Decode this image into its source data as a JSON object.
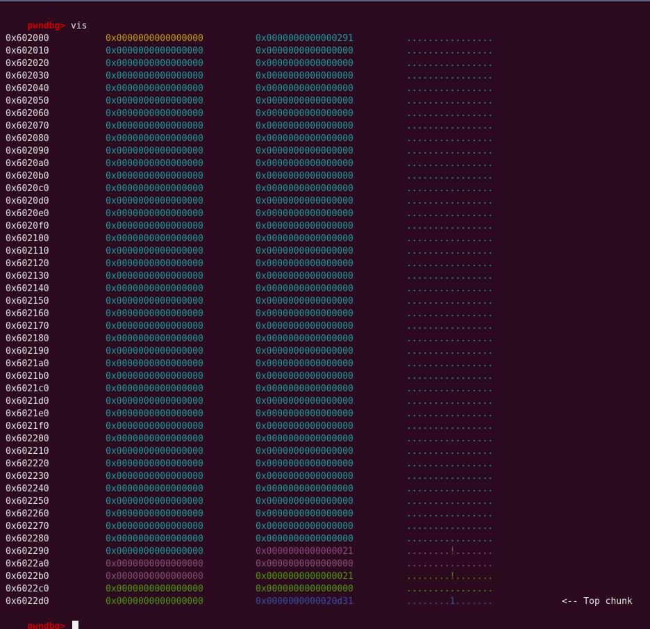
{
  "terminal": {
    "colors": {
      "background": "#2c0a1f",
      "prompt": "#cc0000",
      "text": "#e6e6e6",
      "cyan": "#1a9e9e",
      "yellow": "#c4a000",
      "purple": "#8a4f7a",
      "green": "#4e9a06",
      "blue": "#3b4fa8"
    },
    "prompt": "pwndbg>",
    "command": "vis",
    "final_prompt": "pwndbg>",
    "rows": [
      {
        "addr": "0x602000",
        "w1": "0x0000000000000000",
        "w2": "0x0000000000000291",
        "ascii": "................",
        "c1": "#c4a000",
        "c2": "#1a9e9e",
        "c3": "#1a9e9e",
        "ann": ""
      },
      {
        "addr": "0x602010",
        "w1": "0x0000000000000000",
        "w2": "0x0000000000000000",
        "ascii": "................",
        "c1": "#1a9e9e",
        "c2": "#1a9e9e",
        "c3": "#1a9e9e",
        "ann": ""
      },
      {
        "addr": "0x602020",
        "w1": "0x0000000000000000",
        "w2": "0x0000000000000000",
        "ascii": "................",
        "c1": "#1a9e9e",
        "c2": "#1a9e9e",
        "c3": "#1a9e9e",
        "ann": ""
      },
      {
        "addr": "0x602030",
        "w1": "0x0000000000000000",
        "w2": "0x0000000000000000",
        "ascii": "................",
        "c1": "#1a9e9e",
        "c2": "#1a9e9e",
        "c3": "#1a9e9e",
        "ann": ""
      },
      {
        "addr": "0x602040",
        "w1": "0x0000000000000000",
        "w2": "0x0000000000000000",
        "ascii": "................",
        "c1": "#1a9e9e",
        "c2": "#1a9e9e",
        "c3": "#1a9e9e",
        "ann": ""
      },
      {
        "addr": "0x602050",
        "w1": "0x0000000000000000",
        "w2": "0x0000000000000000",
        "ascii": "................",
        "c1": "#1a9e9e",
        "c2": "#1a9e9e",
        "c3": "#1a9e9e",
        "ann": ""
      },
      {
        "addr": "0x602060",
        "w1": "0x0000000000000000",
        "w2": "0x0000000000000000",
        "ascii": "................",
        "c1": "#1a9e9e",
        "c2": "#1a9e9e",
        "c3": "#1a9e9e",
        "ann": ""
      },
      {
        "addr": "0x602070",
        "w1": "0x0000000000000000",
        "w2": "0x0000000000000000",
        "ascii": "................",
        "c1": "#1a9e9e",
        "c2": "#1a9e9e",
        "c3": "#1a9e9e",
        "ann": ""
      },
      {
        "addr": "0x602080",
        "w1": "0x0000000000000000",
        "w2": "0x0000000000000000",
        "ascii": "................",
        "c1": "#1a9e9e",
        "c2": "#1a9e9e",
        "c3": "#1a9e9e",
        "ann": ""
      },
      {
        "addr": "0x602090",
        "w1": "0x0000000000000000",
        "w2": "0x0000000000000000",
        "ascii": "................",
        "c1": "#1a9e9e",
        "c2": "#1a9e9e",
        "c3": "#1a9e9e",
        "ann": ""
      },
      {
        "addr": "0x6020a0",
        "w1": "0x0000000000000000",
        "w2": "0x0000000000000000",
        "ascii": "................",
        "c1": "#1a9e9e",
        "c2": "#1a9e9e",
        "c3": "#1a9e9e",
        "ann": ""
      },
      {
        "addr": "0x6020b0",
        "w1": "0x0000000000000000",
        "w2": "0x0000000000000000",
        "ascii": "................",
        "c1": "#1a9e9e",
        "c2": "#1a9e9e",
        "c3": "#1a9e9e",
        "ann": ""
      },
      {
        "addr": "0x6020c0",
        "w1": "0x0000000000000000",
        "w2": "0x0000000000000000",
        "ascii": "................",
        "c1": "#1a9e9e",
        "c2": "#1a9e9e",
        "c3": "#1a9e9e",
        "ann": ""
      },
      {
        "addr": "0x6020d0",
        "w1": "0x0000000000000000",
        "w2": "0x0000000000000000",
        "ascii": "................",
        "c1": "#1a9e9e",
        "c2": "#1a9e9e",
        "c3": "#1a9e9e",
        "ann": ""
      },
      {
        "addr": "0x6020e0",
        "w1": "0x0000000000000000",
        "w2": "0x0000000000000000",
        "ascii": "................",
        "c1": "#1a9e9e",
        "c2": "#1a9e9e",
        "c3": "#1a9e9e",
        "ann": ""
      },
      {
        "addr": "0x6020f0",
        "w1": "0x0000000000000000",
        "w2": "0x0000000000000000",
        "ascii": "................",
        "c1": "#1a9e9e",
        "c2": "#1a9e9e",
        "c3": "#1a9e9e",
        "ann": ""
      },
      {
        "addr": "0x602100",
        "w1": "0x0000000000000000",
        "w2": "0x0000000000000000",
        "ascii": "................",
        "c1": "#1a9e9e",
        "c2": "#1a9e9e",
        "c3": "#1a9e9e",
        "ann": ""
      },
      {
        "addr": "0x602110",
        "w1": "0x0000000000000000",
        "w2": "0x0000000000000000",
        "ascii": "................",
        "c1": "#1a9e9e",
        "c2": "#1a9e9e",
        "c3": "#1a9e9e",
        "ann": ""
      },
      {
        "addr": "0x602120",
        "w1": "0x0000000000000000",
        "w2": "0x0000000000000000",
        "ascii": "................",
        "c1": "#1a9e9e",
        "c2": "#1a9e9e",
        "c3": "#1a9e9e",
        "ann": ""
      },
      {
        "addr": "0x602130",
        "w1": "0x0000000000000000",
        "w2": "0x0000000000000000",
        "ascii": "................",
        "c1": "#1a9e9e",
        "c2": "#1a9e9e",
        "c3": "#1a9e9e",
        "ann": ""
      },
      {
        "addr": "0x602140",
        "w1": "0x0000000000000000",
        "w2": "0x0000000000000000",
        "ascii": "................",
        "c1": "#1a9e9e",
        "c2": "#1a9e9e",
        "c3": "#1a9e9e",
        "ann": ""
      },
      {
        "addr": "0x602150",
        "w1": "0x0000000000000000",
        "w2": "0x0000000000000000",
        "ascii": "................",
        "c1": "#1a9e9e",
        "c2": "#1a9e9e",
        "c3": "#1a9e9e",
        "ann": ""
      },
      {
        "addr": "0x602160",
        "w1": "0x0000000000000000",
        "w2": "0x0000000000000000",
        "ascii": "................",
        "c1": "#1a9e9e",
        "c2": "#1a9e9e",
        "c3": "#1a9e9e",
        "ann": ""
      },
      {
        "addr": "0x602170",
        "w1": "0x0000000000000000",
        "w2": "0x0000000000000000",
        "ascii": "................",
        "c1": "#1a9e9e",
        "c2": "#1a9e9e",
        "c3": "#1a9e9e",
        "ann": ""
      },
      {
        "addr": "0x602180",
        "w1": "0x0000000000000000",
        "w2": "0x0000000000000000",
        "ascii": "................",
        "c1": "#1a9e9e",
        "c2": "#1a9e9e",
        "c3": "#1a9e9e",
        "ann": ""
      },
      {
        "addr": "0x602190",
        "w1": "0x0000000000000000",
        "w2": "0x0000000000000000",
        "ascii": "................",
        "c1": "#1a9e9e",
        "c2": "#1a9e9e",
        "c3": "#1a9e9e",
        "ann": ""
      },
      {
        "addr": "0x6021a0",
        "w1": "0x0000000000000000",
        "w2": "0x0000000000000000",
        "ascii": "................",
        "c1": "#1a9e9e",
        "c2": "#1a9e9e",
        "c3": "#1a9e9e",
        "ann": ""
      },
      {
        "addr": "0x6021b0",
        "w1": "0x0000000000000000",
        "w2": "0x0000000000000000",
        "ascii": "................",
        "c1": "#1a9e9e",
        "c2": "#1a9e9e",
        "c3": "#1a9e9e",
        "ann": ""
      },
      {
        "addr": "0x6021c0",
        "w1": "0x0000000000000000",
        "w2": "0x0000000000000000",
        "ascii": "................",
        "c1": "#1a9e9e",
        "c2": "#1a9e9e",
        "c3": "#1a9e9e",
        "ann": ""
      },
      {
        "addr": "0x6021d0",
        "w1": "0x0000000000000000",
        "w2": "0x0000000000000000",
        "ascii": "................",
        "c1": "#1a9e9e",
        "c2": "#1a9e9e",
        "c3": "#1a9e9e",
        "ann": ""
      },
      {
        "addr": "0x6021e0",
        "w1": "0x0000000000000000",
        "w2": "0x0000000000000000",
        "ascii": "................",
        "c1": "#1a9e9e",
        "c2": "#1a9e9e",
        "c3": "#1a9e9e",
        "ann": ""
      },
      {
        "addr": "0x6021f0",
        "w1": "0x0000000000000000",
        "w2": "0x0000000000000000",
        "ascii": "................",
        "c1": "#1a9e9e",
        "c2": "#1a9e9e",
        "c3": "#1a9e9e",
        "ann": ""
      },
      {
        "addr": "0x602200",
        "w1": "0x0000000000000000",
        "w2": "0x0000000000000000",
        "ascii": "................",
        "c1": "#1a9e9e",
        "c2": "#1a9e9e",
        "c3": "#1a9e9e",
        "ann": ""
      },
      {
        "addr": "0x602210",
        "w1": "0x0000000000000000",
        "w2": "0x0000000000000000",
        "ascii": "................",
        "c1": "#1a9e9e",
        "c2": "#1a9e9e",
        "c3": "#1a9e9e",
        "ann": ""
      },
      {
        "addr": "0x602220",
        "w1": "0x0000000000000000",
        "w2": "0x0000000000000000",
        "ascii": "................",
        "c1": "#1a9e9e",
        "c2": "#1a9e9e",
        "c3": "#1a9e9e",
        "ann": ""
      },
      {
        "addr": "0x602230",
        "w1": "0x0000000000000000",
        "w2": "0x0000000000000000",
        "ascii": "................",
        "c1": "#1a9e9e",
        "c2": "#1a9e9e",
        "c3": "#1a9e9e",
        "ann": ""
      },
      {
        "addr": "0x602240",
        "w1": "0x0000000000000000",
        "w2": "0x0000000000000000",
        "ascii": "................",
        "c1": "#1a9e9e",
        "c2": "#1a9e9e",
        "c3": "#1a9e9e",
        "ann": ""
      },
      {
        "addr": "0x602250",
        "w1": "0x0000000000000000",
        "w2": "0x0000000000000000",
        "ascii": "................",
        "c1": "#1a9e9e",
        "c2": "#1a9e9e",
        "c3": "#1a9e9e",
        "ann": ""
      },
      {
        "addr": "0x602260",
        "w1": "0x0000000000000000",
        "w2": "0x0000000000000000",
        "ascii": "................",
        "c1": "#1a9e9e",
        "c2": "#1a9e9e",
        "c3": "#1a9e9e",
        "ann": ""
      },
      {
        "addr": "0x602270",
        "w1": "0x0000000000000000",
        "w2": "0x0000000000000000",
        "ascii": "................",
        "c1": "#1a9e9e",
        "c2": "#1a9e9e",
        "c3": "#1a9e9e",
        "ann": ""
      },
      {
        "addr": "0x602280",
        "w1": "0x0000000000000000",
        "w2": "0x0000000000000000",
        "ascii": "................",
        "c1": "#1a9e9e",
        "c2": "#1a9e9e",
        "c3": "#1a9e9e",
        "ann": ""
      },
      {
        "addr": "0x602290",
        "w1": "0x0000000000000000",
        "w2": "0x0000000000000021",
        "ascii": "........!.......",
        "c1": "#1a9e9e",
        "c2": "#8a4f7a",
        "c3": "#8a4f7a",
        "ann": ""
      },
      {
        "addr": "0x6022a0",
        "w1": "0x0000000000000000",
        "w2": "0x0000000000000000",
        "ascii": "................",
        "c1": "#8a4f7a",
        "c2": "#8a4f7a",
        "c3": "#8a4f7a",
        "ann": ""
      },
      {
        "addr": "0x6022b0",
        "w1": "0x0000000000000000",
        "w2": "0x0000000000000021",
        "ascii": "........!.......",
        "c1": "#8a4f7a",
        "c2": "#4e9a06",
        "c3": "#4e9a06",
        "ann": ""
      },
      {
        "addr": "0x6022c0",
        "w1": "0x0000000000000000",
        "w2": "0x0000000000000000",
        "ascii": "................",
        "c1": "#4e9a06",
        "c2": "#4e9a06",
        "c3": "#4e9a06",
        "ann": ""
      },
      {
        "addr": "0x6022d0",
        "w1": "0x0000000000000000",
        "w2": "0x0000000000020d31",
        "ascii": "........1.......",
        "c1": "#4e9a06",
        "c2": "#3b4fa8",
        "c3": "#3b4fa8",
        "ann": "<-- Top chunk"
      }
    ]
  }
}
